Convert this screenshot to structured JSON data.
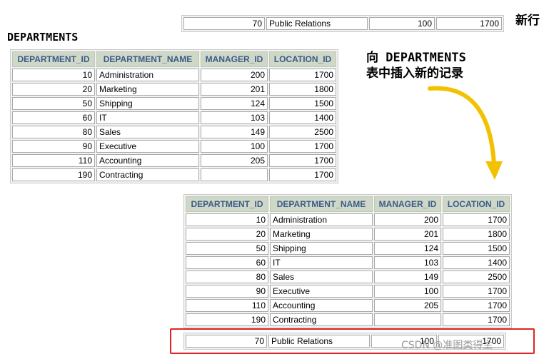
{
  "new_row_label": "新行",
  "new_row": [
    "70",
    "Public Relations",
    "100",
    "1700"
  ],
  "table_title": "DEPARTMENTS",
  "columns": [
    "DEPARTMENT_ID",
    "DEPARTMENT_NAME",
    "MANAGER_ID",
    "LOCATION_ID"
  ],
  "rows": [
    [
      "10",
      "Administration",
      "200",
      "1700"
    ],
    [
      "20",
      "Marketing",
      "201",
      "1800"
    ],
    [
      "50",
      "Shipping",
      "124",
      "1500"
    ],
    [
      "60",
      "IT",
      "103",
      "1400"
    ],
    [
      "80",
      "Sales",
      "149",
      "2500"
    ],
    [
      "90",
      "Executive",
      "100",
      "1700"
    ],
    [
      "110",
      "Accounting",
      "205",
      "1700"
    ],
    [
      "190",
      "Contracting",
      "",
      "1700"
    ]
  ],
  "note": {
    "line1": "向 DEPARTMENTS",
    "line2": "表中插入新的记录"
  },
  "watermark": "CSDN @准图类得主",
  "colors": {
    "header_bg": "#cfd8c7",
    "header_text": "#3b5b8c",
    "arrow": "#f2c200",
    "highlight": "#e02424"
  }
}
